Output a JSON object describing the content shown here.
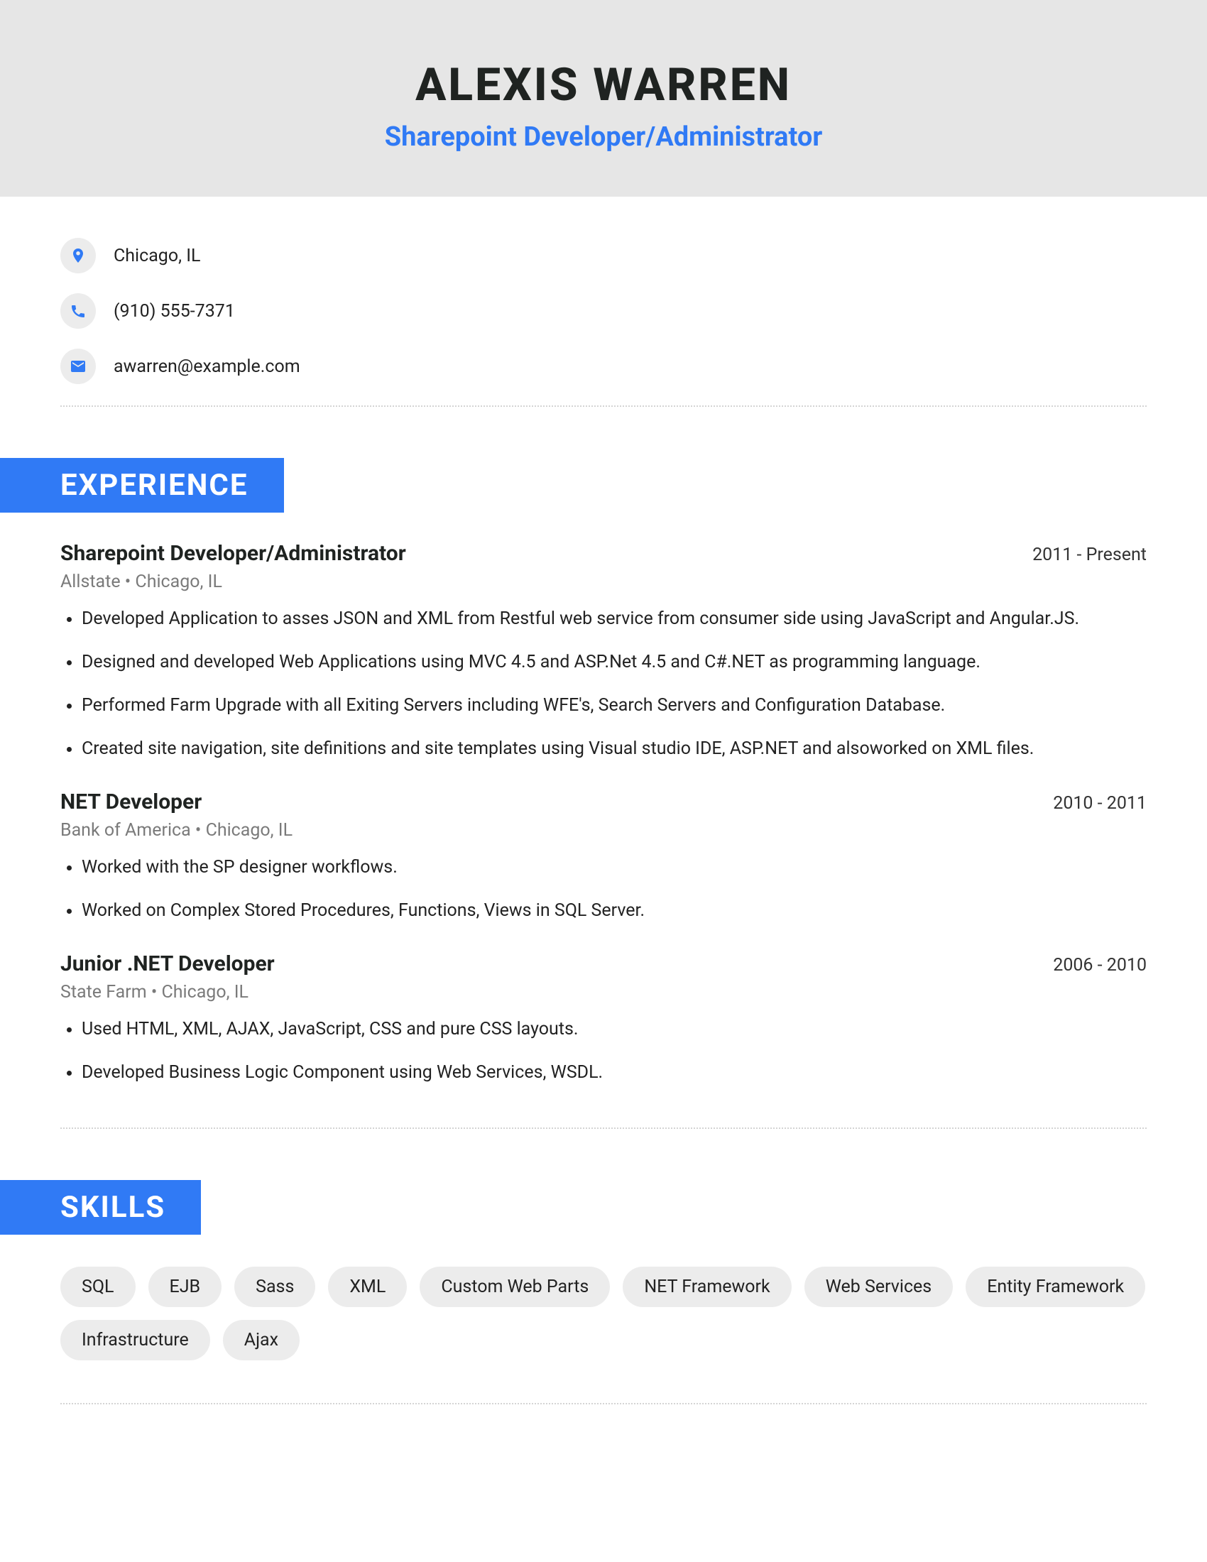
{
  "header": {
    "name": "ALEXIS WARREN",
    "title": "Sharepoint Developer/Administrator"
  },
  "contact": {
    "location": "Chicago, IL",
    "phone": "(910) 555-7371",
    "email": "awarren@example.com"
  },
  "sections": {
    "experience_label": "EXPERIENCE",
    "skills_label": "SKILLS"
  },
  "experience": [
    {
      "title": "Sharepoint Developer/Administrator",
      "dates": "2011 - Present",
      "sub": "Allstate  •  Chicago, IL",
      "bullets": [
        "Developed Application to asses JSON and XML from Restful web service from consumer side using JavaScript and Angular.JS.",
        "Designed and developed Web Applications using MVC 4.5 and ASP.Net 4.5 and C#.NET as programming language.",
        "Performed Farm Upgrade with all Exiting Servers including WFE's, Search Servers and Configuration Database.",
        "Created site navigation, site definitions and site templates using Visual studio IDE, ASP.NET and alsoworked on XML files."
      ]
    },
    {
      "title": "NET Developer",
      "dates": "2010 - 2011",
      "sub": "Bank of America  •  Chicago, IL",
      "bullets": [
        "Worked with the SP designer workflows.",
        "Worked on Complex Stored Procedures, Functions, Views in SQL Server."
      ]
    },
    {
      "title": "Junior .NET Developer",
      "dates": "2006 - 2010",
      "sub": "State Farm  •  Chicago, IL",
      "bullets": [
        "Used HTML, XML, AJAX, JavaScript, CSS and pure CSS layouts.",
        "Developed Business Logic Component using Web Services, WSDL."
      ]
    }
  ],
  "skills": [
    "SQL",
    "EJB",
    "Sass",
    "XML",
    "Custom Web Parts",
    "NET Framework",
    "Web Services",
    "Entity Framework",
    "Infrastructure",
    "Ajax"
  ]
}
